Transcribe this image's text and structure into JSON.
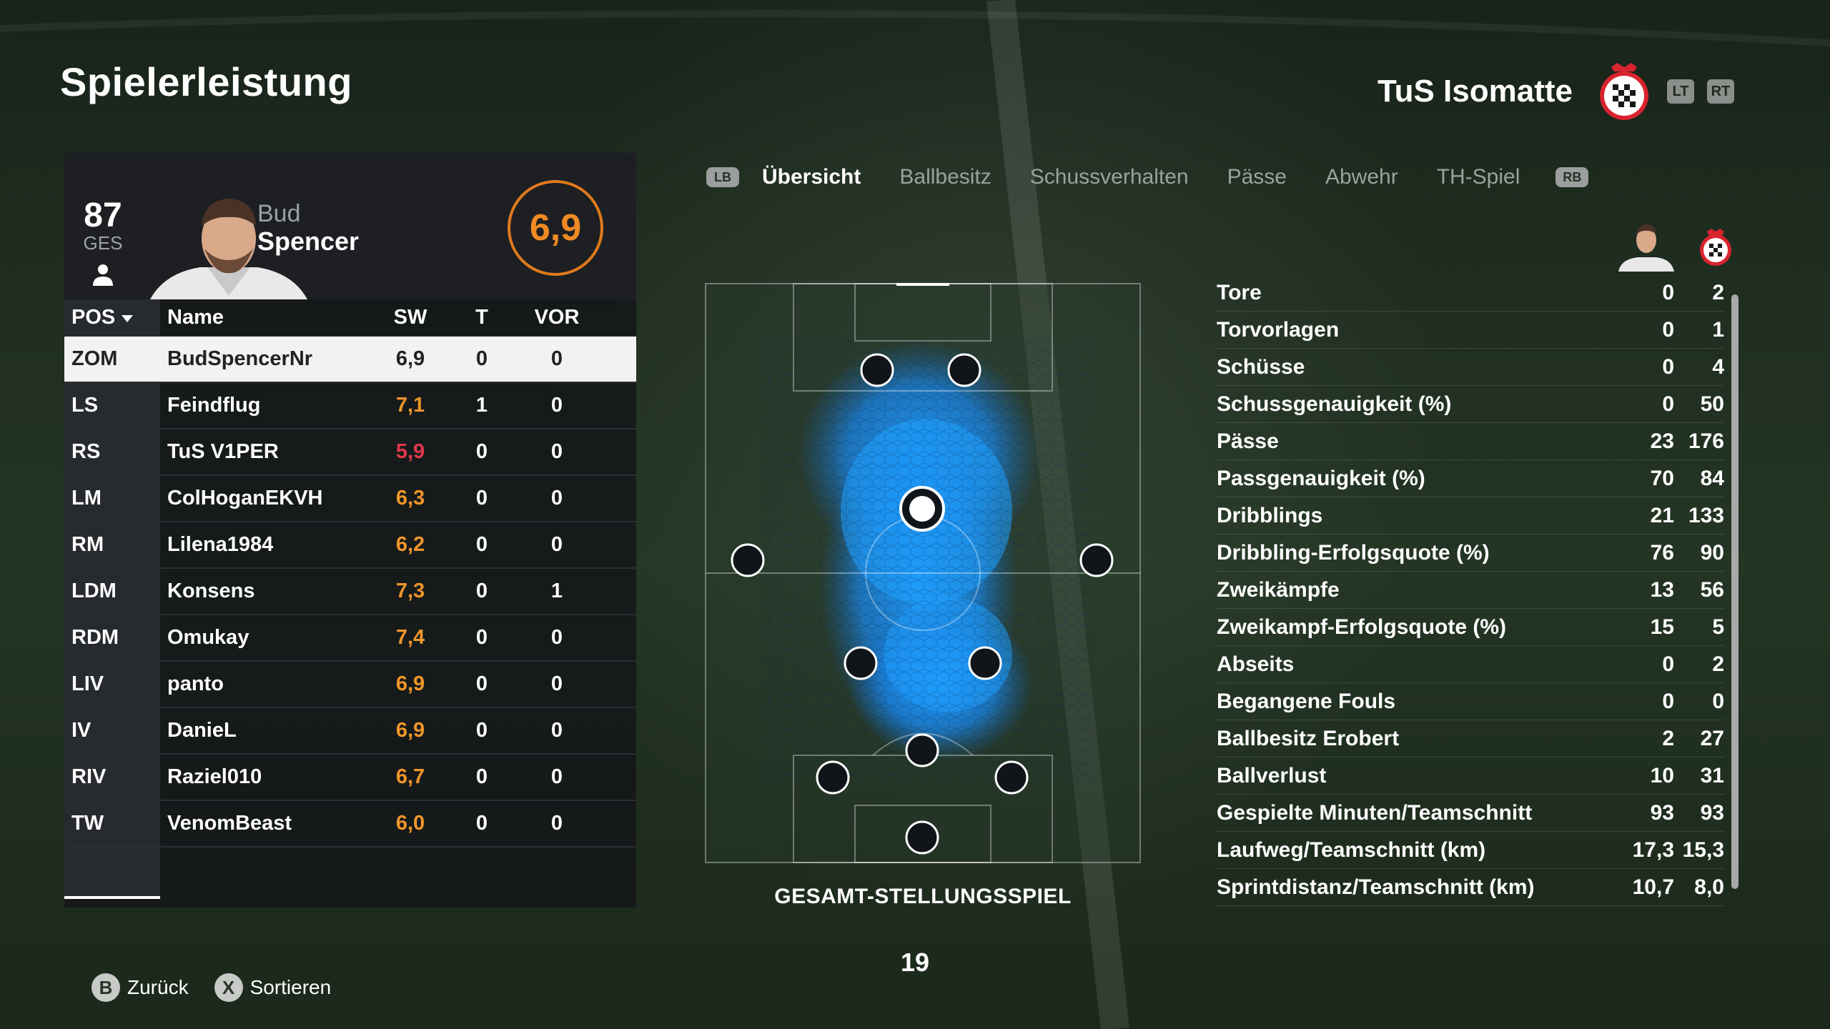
{
  "header": {
    "title": "Spielerleistung",
    "team_name": "TuS Isomatte",
    "left_trigger": "LT",
    "right_trigger": "RT"
  },
  "player_card": {
    "overall_value": "87",
    "overall_label": "GES",
    "first_name": "Bud",
    "last_name": "Spencer",
    "match_rating": "6,9"
  },
  "table": {
    "headers": {
      "pos": "POS",
      "name": "Name",
      "sw": "SW",
      "t": "T",
      "vor": "VOR"
    },
    "rows": [
      {
        "pos": "ZOM",
        "name": "BudSpencerNr",
        "sw": "6,9",
        "t": "0",
        "vor": "0"
      },
      {
        "pos": "LS",
        "name": "Feindflug",
        "sw": "7,1",
        "t": "1",
        "vor": "0"
      },
      {
        "pos": "RS",
        "name": "TuS V1PER",
        "sw": "5,9",
        "t": "0",
        "vor": "0"
      },
      {
        "pos": "LM",
        "name": "ColHoganEKVH",
        "sw": "6,3",
        "t": "0",
        "vor": "0"
      },
      {
        "pos": "RM",
        "name": "Lilena1984",
        "sw": "6,2",
        "t": "0",
        "vor": "0"
      },
      {
        "pos": "LDM",
        "name": "Konsens",
        "sw": "7,3",
        "t": "0",
        "vor": "1"
      },
      {
        "pos": "RDM",
        "name": "Omukay",
        "sw": "7,4",
        "t": "0",
        "vor": "0"
      },
      {
        "pos": "LIV",
        "name": "panto",
        "sw": "6,9",
        "t": "0",
        "vor": "0"
      },
      {
        "pos": "IV",
        "name": "DanieL",
        "sw": "6,9",
        "t": "0",
        "vor": "0"
      },
      {
        "pos": "RIV",
        "name": "Raziel010",
        "sw": "6,7",
        "t": "0",
        "vor": "0"
      },
      {
        "pos": "TW",
        "name": "VenomBeast",
        "sw": "6,0",
        "t": "0",
        "vor": "0"
      }
    ]
  },
  "tabs": {
    "left_bumper": "LB",
    "right_bumper": "RB",
    "items": [
      "Übersicht",
      "Ballbesitz",
      "Schussverhalten",
      "Pässe",
      "Abwehr",
      "TH-Spiel"
    ]
  },
  "pitch": {
    "caption": "GESAMT-STELLUNGSSPIEL",
    "page_number": "19"
  },
  "stats": [
    {
      "label": "Tore",
      "player": "0",
      "team": "2"
    },
    {
      "label": "Torvorlagen",
      "player": "0",
      "team": "1"
    },
    {
      "label": "Schüsse",
      "player": "0",
      "team": "4"
    },
    {
      "label": "Schussgenauigkeit (%)",
      "player": "0",
      "team": "50"
    },
    {
      "label": "Pässe",
      "player": "23",
      "team": "176"
    },
    {
      "label": "Passgenauigkeit (%)",
      "player": "70",
      "team": "84"
    },
    {
      "label": "Dribblings",
      "player": "21",
      "team": "133"
    },
    {
      "label": "Dribbling-Erfolgsquote (%)",
      "player": "76",
      "team": "90"
    },
    {
      "label": "Zweikämpfe",
      "player": "13",
      "team": "56"
    },
    {
      "label": "Zweikampf-Erfolgsquote (%)",
      "player": "15",
      "team": "5"
    },
    {
      "label": "Abseits",
      "player": "0",
      "team": "2"
    },
    {
      "label": "Begangene Fouls",
      "player": "0",
      "team": "0"
    },
    {
      "label": "Ballbesitz Erobert",
      "player": "2",
      "team": "27"
    },
    {
      "label": "Ballverlust",
      "player": "10",
      "team": "31"
    },
    {
      "label": "Gespielte Minuten/Teamschnitt",
      "player": "93",
      "team": "93"
    },
    {
      "label": "Laufweg/Teamschnitt (km)",
      "player": "17,3",
      "team": "15,3"
    },
    {
      "label": "Sprintdistanz/Teamschnitt (km)",
      "player": "10,7",
      "team": "8,0"
    }
  ],
  "footer": {
    "back_button": "B",
    "back_label": "Zurück",
    "sort_button": "X",
    "sort_label": "Sortieren"
  },
  "colors": {
    "rating_orange": "#f08a24",
    "rating_red": "#e0384a",
    "heatmap_blue": "#1e90ff",
    "selected_row": "#f2f2f2"
  },
  "icons": {
    "crest": "club-crest-icon",
    "person": "person-icon",
    "sort_arrow": "caret-down-icon"
  }
}
